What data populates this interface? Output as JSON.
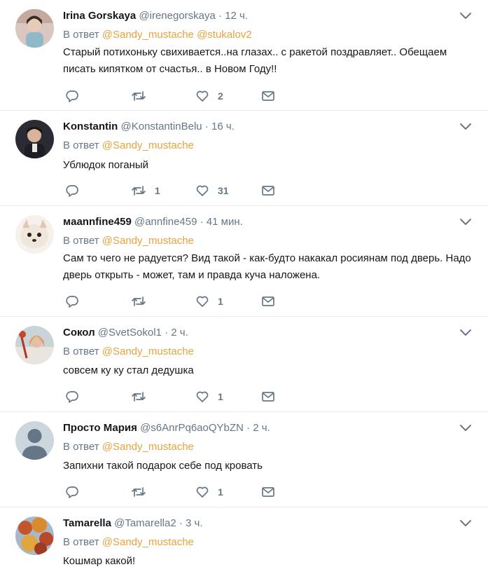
{
  "reply_prefix": "В ответ",
  "tweets": [
    {
      "name": "Irina Gorskaya",
      "handle": "@irenegorskaya",
      "time": "12 ч.",
      "mentions": [
        "@Sandy_mustache",
        "@stukalov2"
      ],
      "text": "Старый потихоньку свихивается..на глазах.. с ракетой поздравляет.. Обещаем писать кипятком от счастья.. в Новом Году!!",
      "replies": "",
      "retweets": "",
      "likes": "2"
    },
    {
      "name": "Konstantin",
      "handle": "@KonstantinBelu",
      "time": "16 ч.",
      "mentions": [
        "@Sandy_mustache"
      ],
      "text": "Ублюдок поганый",
      "replies": "",
      "retweets": "1",
      "likes": "31"
    },
    {
      "name": "мaannfine459",
      "handle": "@annfine459",
      "time": "41 мин.",
      "mentions": [
        "@Sandy_mustache"
      ],
      "text": "Сам то чего не радуется? Вид такой - как-будто накакал росиянам под дверь. Надо дверь открыть - может, там и правда куча наложена.",
      "replies": "",
      "retweets": "",
      "likes": "1"
    },
    {
      "name": "Сокол",
      "handle": "@SvetSokol1",
      "time": "2 ч.",
      "mentions": [
        "@Sandy_mustache"
      ],
      "text": "совсем ку ку стал дедушка",
      "replies": "",
      "retweets": "",
      "likes": "1"
    },
    {
      "name": "Просто Мария",
      "handle": "@s6AnrPq6aoQYbZN",
      "time": "2 ч.",
      "mentions": [
        "@Sandy_mustache"
      ],
      "text": "Запихни такой подарок себе под кровать",
      "replies": "",
      "retweets": "",
      "likes": "1"
    },
    {
      "name": "Tamarella",
      "handle": "@Tamarella2",
      "time": "3 ч.",
      "mentions": [
        "@Sandy_mustache"
      ],
      "text": "Кошмар какой!",
      "replies": "",
      "retweets": "",
      "likes": ""
    }
  ],
  "colors": {
    "mention": "#e8a33d",
    "secondary_text": "#657786",
    "divider": "#e6ecf0"
  },
  "icons": [
    "reply-icon",
    "retweet-icon",
    "like-icon",
    "direct-message-icon",
    "chevron-down-icon"
  ]
}
